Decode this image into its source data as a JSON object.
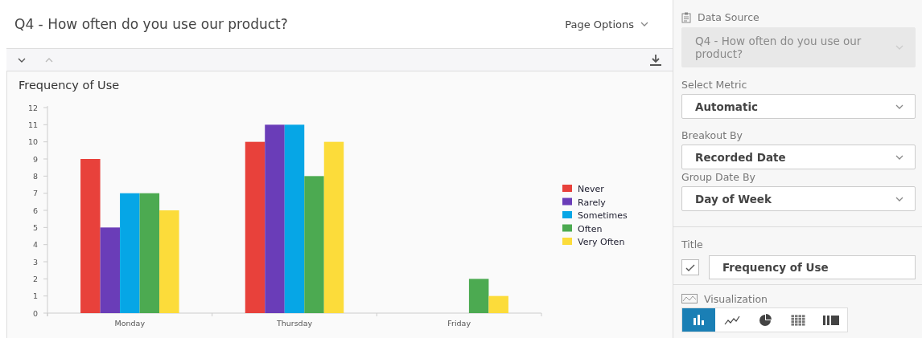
{
  "header": {
    "title": "Q4 - How often do you use our product?",
    "page_options": "Page Options"
  },
  "chart_card": {
    "title": "Frequency of Use",
    "chart_data": {
      "type": "bar",
      "categories": [
        "Monday",
        "Thursday",
        "Friday"
      ],
      "legend": "right",
      "ylim": [
        0,
        12
      ],
      "yticks": [
        0,
        1,
        2,
        3,
        4,
        5,
        6,
        7,
        8,
        9,
        10,
        11,
        12
      ],
      "series": [
        {
          "name": "Never",
          "color": "#e8413b",
          "values": [
            9,
            10,
            null
          ]
        },
        {
          "name": "Rarely",
          "color": "#6a3db8",
          "values": [
            5,
            11,
            null
          ]
        },
        {
          "name": "Sometimes",
          "color": "#06a6e6",
          "values": [
            7,
            11,
            null
          ]
        },
        {
          "name": "Often",
          "color": "#4caa51",
          "values": [
            7,
            8,
            2
          ]
        },
        {
          "name": "Very Often",
          "color": "#fcdc3a",
          "values": [
            6,
            10,
            1
          ]
        }
      ]
    }
  },
  "sidebar": {
    "data_source": {
      "label": "Data Source",
      "value": "Q4 - How often do you use our product?",
      "disabled": true
    },
    "selects": [
      {
        "label": "Select Metric",
        "value": "Automatic"
      },
      {
        "label": "Breakout By",
        "value": "Recorded Date"
      },
      {
        "label": "Group Date By",
        "value": "Day of Week"
      }
    ],
    "title_field": {
      "label": "Title",
      "checked": true,
      "value": "Frequency of Use"
    },
    "visualization": {
      "label": "Visualization",
      "options": [
        {
          "kind": "bar",
          "selected": true
        },
        {
          "kind": "line",
          "selected": false
        },
        {
          "kind": "pie",
          "selected": false
        },
        {
          "kind": "table",
          "selected": false
        },
        {
          "kind": "columns",
          "selected": false
        }
      ]
    }
  }
}
